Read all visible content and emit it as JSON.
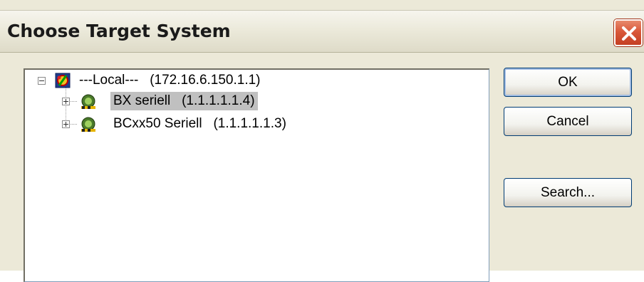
{
  "dialog": {
    "title": "Choose Target System",
    "close_icon": "close-x-icon"
  },
  "tree": {
    "root": {
      "label": "---Local---   (172.16.6.150.1.1)",
      "icon": "target-system-icon",
      "expanded": true
    },
    "children": [
      {
        "label": "BX seriell   (1.1.1.1.1.4)",
        "icon": "remote-system-icon",
        "selected": true,
        "expanded": false
      },
      {
        "label": "BCxx50 Seriell   (1.1.1.1.1.3)",
        "icon": "remote-system-icon",
        "selected": false,
        "expanded": false
      }
    ]
  },
  "buttons": {
    "ok": "OK",
    "cancel": "Cancel",
    "search": "Search..."
  },
  "colors": {
    "dialog_bg": "#ece9d8",
    "close_button": "#d9583a",
    "selection": "#c0c0c0",
    "button_border": "#003c74"
  }
}
